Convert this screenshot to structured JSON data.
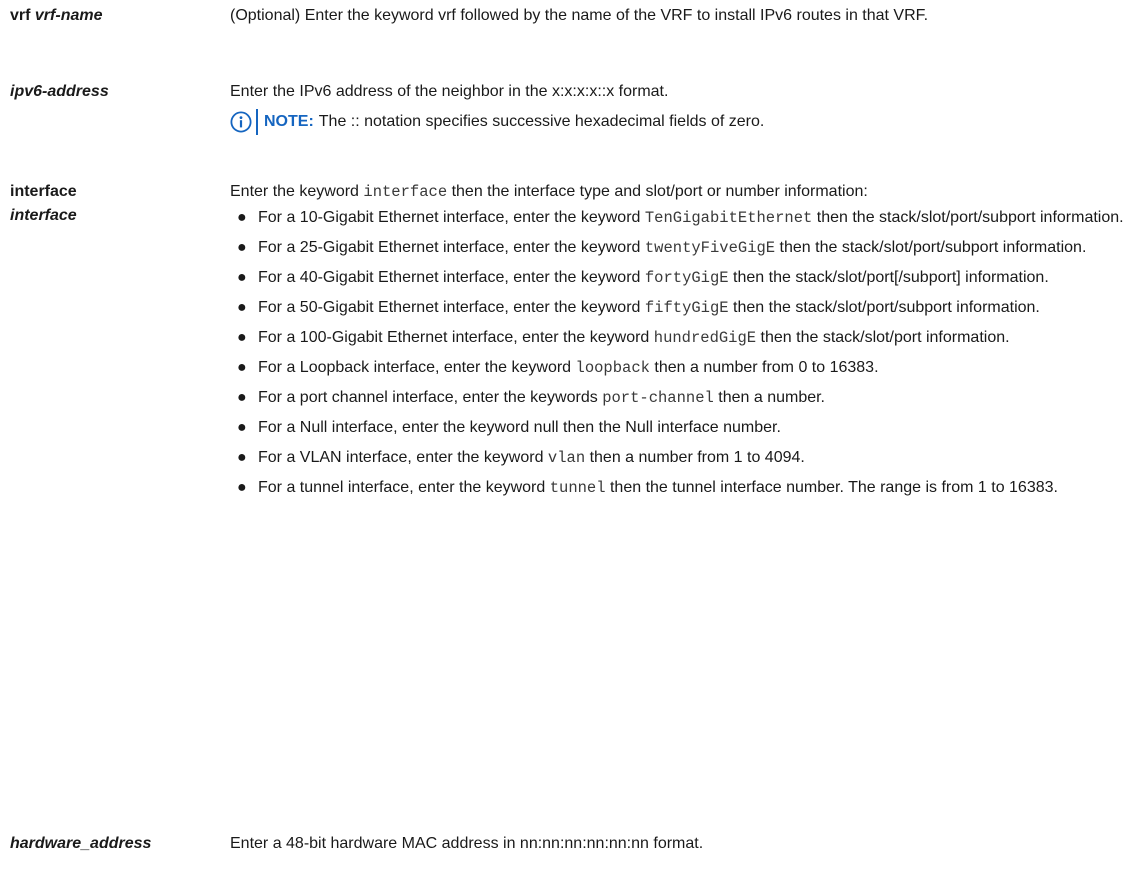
{
  "rows": {
    "vrf": {
      "term_keyword": "vrf",
      "term_arg": "vrf-name",
      "desc": "(Optional) Enter the keyword vrf followed by the name of the VRF to install IPv6 routes in that VRF."
    },
    "ipv6": {
      "term": "ipv6-address",
      "desc": "Enter the IPv6 address of the neighbor in the x:x:x:x::x format.",
      "note_label": "NOTE:",
      "note_text": "The :: notation specifies successive hexadecimal fields of zero.",
      "note_icon": "info-icon"
    },
    "interface": {
      "term_keyword": "interface",
      "term_arg": "interface",
      "intro_pre": "Enter the keyword ",
      "intro_code": "interface",
      "intro_post": " then the interface type and slot/port or number information:",
      "bullet_glyph": "●",
      "bullets": [
        {
          "pre": "For a 10-Gigabit Ethernet interface, enter the keyword ",
          "code": "TenGigabitEthernet",
          "post": " then the stack/slot/port/subport information."
        },
        {
          "pre": "For a 25-Gigabit Ethernet interface, enter the keyword ",
          "code": "twentyFiveGigE",
          "post": " then the stack/slot/port/subport information."
        },
        {
          "pre": "For a 40-Gigabit Ethernet interface, enter the keyword ",
          "code": "fortyGigE",
          "post": " then the stack/slot/port[/subport] information."
        },
        {
          "pre": "For a 50-Gigabit Ethernet interface, enter the keyword ",
          "code": "fiftyGigE",
          "post": " then the stack/slot/port/subport information."
        },
        {
          "pre": "For a 100-Gigabit Ethernet interface, enter the keyword ",
          "code": "hundredGigE",
          "post": " then the stack/slot/port information."
        },
        {
          "pre": "For a Loopback interface, enter the keyword ",
          "code": "loopback",
          "post": " then a number from 0 to 16383."
        },
        {
          "pre": "For a port channel interface, enter the keywords ",
          "code": "port-channel",
          "post": " then a number."
        },
        {
          "pre": "For a Null interface, enter the keyword null then the Null interface number.",
          "code": "",
          "post": ""
        },
        {
          "pre": "For a VLAN interface, enter the keyword ",
          "code": "vlan",
          "post": " then a number from 1 to 4094."
        },
        {
          "pre": "For a tunnel interface, enter the keyword ",
          "code": "tunnel",
          "post": " then the tunnel interface number. The range is from 1 to 16383."
        }
      ]
    },
    "hardware": {
      "term": "hardware_address",
      "desc": "Enter a 48-bit hardware MAC address in nn:nn:nn:nn:nn:nn format."
    }
  },
  "colors": {
    "accent": "#1565c0",
    "text": "#1a1a1a"
  }
}
